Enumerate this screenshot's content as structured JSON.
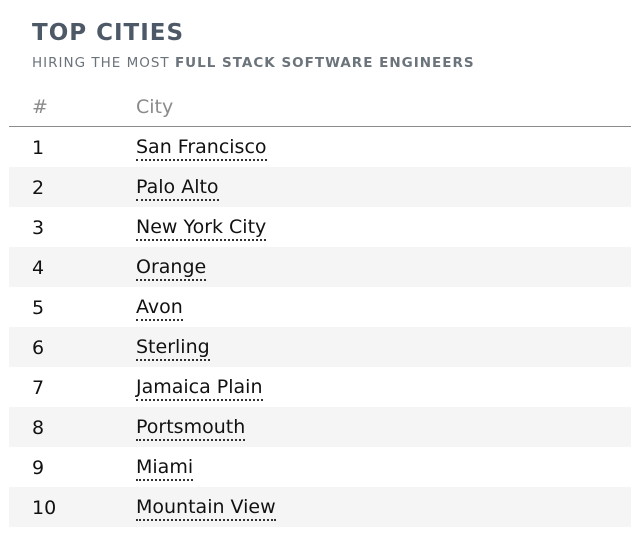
{
  "header": {
    "title": "TOP CITIES",
    "subtitle_prefix": "HIRING THE MOST",
    "subtitle_emphasis": "FULL STACK SOFTWARE ENGINEERS"
  },
  "table": {
    "columns": {
      "rank": "#",
      "city": "City"
    },
    "rows": [
      {
        "rank": "1",
        "city": "San Francisco"
      },
      {
        "rank": "2",
        "city": "Palo Alto"
      },
      {
        "rank": "3",
        "city": "New York City"
      },
      {
        "rank": "4",
        "city": "Orange"
      },
      {
        "rank": "5",
        "city": "Avon"
      },
      {
        "rank": "6",
        "city": "Sterling"
      },
      {
        "rank": "7",
        "city": "Jamaica Plain"
      },
      {
        "rank": "8",
        "city": "Portsmouth"
      },
      {
        "rank": "9",
        "city": "Miami"
      },
      {
        "rank": "10",
        "city": "Mountain View"
      }
    ]
  }
}
